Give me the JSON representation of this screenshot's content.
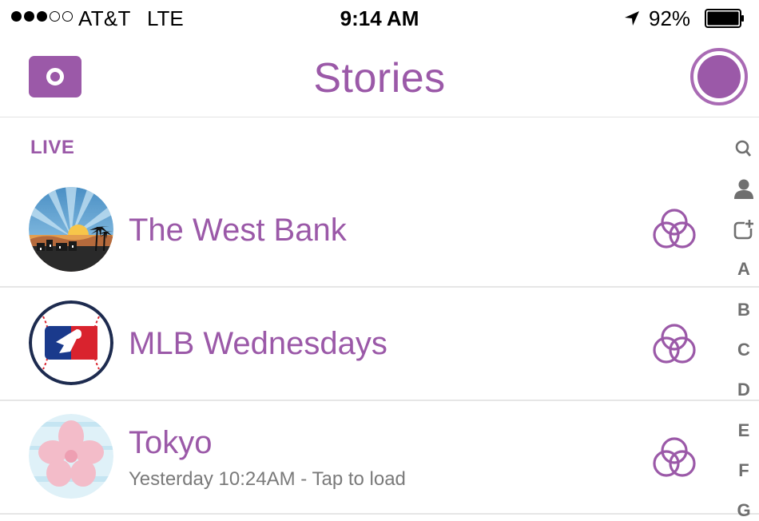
{
  "status_bar": {
    "carrier": "AT&T",
    "network": "LTE",
    "time": "9:14 AM",
    "battery_percent": "92%",
    "signal_bars_filled": 3,
    "signal_bars_total": 5
  },
  "header": {
    "title": "Stories",
    "left_icon": "camera-icon",
    "right_icon": "capture-circle-icon"
  },
  "section": {
    "title": "LIVE"
  },
  "stories": [
    {
      "name": "The West Bank",
      "subtitle": "",
      "avatar": "west-bank-sunset-avatar",
      "status_icon": "story-rings-icon"
    },
    {
      "name": "MLB Wednesdays",
      "subtitle": "",
      "avatar": "mlb-baseball-avatar",
      "status_icon": "story-rings-icon"
    },
    {
      "name": "Tokyo",
      "subtitle": "Yesterday 10:24AM - Tap to load",
      "avatar": "tokyo-flower-avatar",
      "status_icon": "story-rings-icon"
    }
  ],
  "index": {
    "icons": [
      "search-icon",
      "person-icon",
      "add-story-icon"
    ],
    "letters": [
      "A",
      "B",
      "C",
      "D",
      "E",
      "F",
      "G"
    ]
  },
  "colors": {
    "accent": "#9b59a8",
    "subtitle": "#7a7a7a",
    "divider": "#e6e6e6"
  }
}
